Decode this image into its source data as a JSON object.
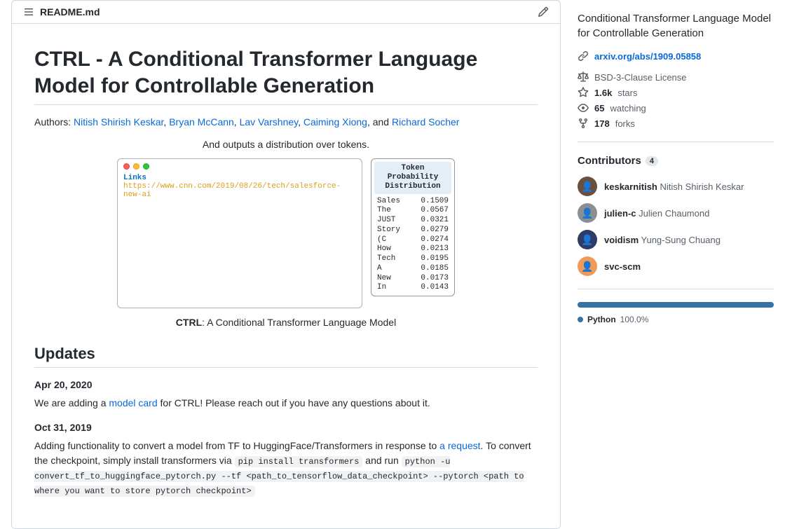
{
  "readme": {
    "filename": "README.md",
    "title": "CTRL - A Conditional Transformer Language Model for Controllable Generation",
    "authors_prefix": "Authors: ",
    "authors": [
      "Nitish Shirish Keskar",
      "Bryan McCann",
      "Lav Varshney",
      "Caiming Xiong",
      "Richard Socher"
    ],
    "authors_and": ", and ",
    "figure": {
      "top_caption": "And outputs a distribution over tokens.",
      "code_prefix": "Links",
      "code_url": "https://www.cnn.com/2019/08/26/tech/salesforce-new-ai",
      "dist_title": "Token Probability Distribution",
      "dist_rows": [
        {
          "token": "Sales",
          "prob": "0.1509"
        },
        {
          "token": "The",
          "prob": "0.0567"
        },
        {
          "token": "JUST",
          "prob": "0.0321"
        },
        {
          "token": "Story",
          "prob": "0.0279"
        },
        {
          "token": "(C",
          "prob": "0.0274"
        },
        {
          "token": "How",
          "prob": "0.0213"
        },
        {
          "token": "Tech",
          "prob": "0.0195"
        },
        {
          "token": "A",
          "prob": "0.0185"
        },
        {
          "token": "New",
          "prob": "0.0173"
        },
        {
          "token": "In",
          "prob": "0.0143"
        }
      ],
      "bottom_bold": "CTRL",
      "bottom_rest": ": A Conditional Transformer Language Model"
    },
    "updates_heading": "Updates",
    "updates": [
      {
        "date": "Apr 20, 2020",
        "pre": "We are adding a ",
        "link": "model card",
        "post": " for CTRL! Please reach out if you have any questions about it."
      },
      {
        "date": "Oct 31, 2019",
        "pre": "Adding functionality to convert a model from TF to HuggingFace/Transformers in response to ",
        "link": "a request",
        "post": ". To convert the checkpoint, simply install transformers via ",
        "code1": "pip install transformers",
        "mid": " and run ",
        "code2": "python -u convert_tf_to_huggingface_pytorch.py --tf <path_to_tensorflow_data_checkpoint> --pytorch <path to where you want to store pytorch checkpoint>"
      }
    ]
  },
  "sidebar": {
    "description": "Conditional Transformer Language Model for Controllable Generation",
    "homepage": "arxiv.org/abs/1909.05858",
    "license": "BSD-3-Clause License",
    "stars": "1.6k",
    "stars_label": "stars",
    "watching": "65",
    "watching_label": "watching",
    "forks": "178",
    "forks_label": "forks",
    "contributors_heading": "Contributors",
    "contributors_count": "4",
    "contributors": [
      {
        "username": "keskarnitish",
        "realname": "Nitish Shirish Keskar",
        "color": "#6b4f3f"
      },
      {
        "username": "julien-c",
        "realname": "Julien Chaumond",
        "color": "#8a8f94"
      },
      {
        "username": "voidism",
        "realname": "Yung-Sung Chuang",
        "color": "#2f3b66"
      },
      {
        "username": "svc-scm",
        "realname": "",
        "color": "#f09a5a"
      }
    ],
    "language": {
      "name": "Python",
      "pct": "100.0%"
    }
  }
}
